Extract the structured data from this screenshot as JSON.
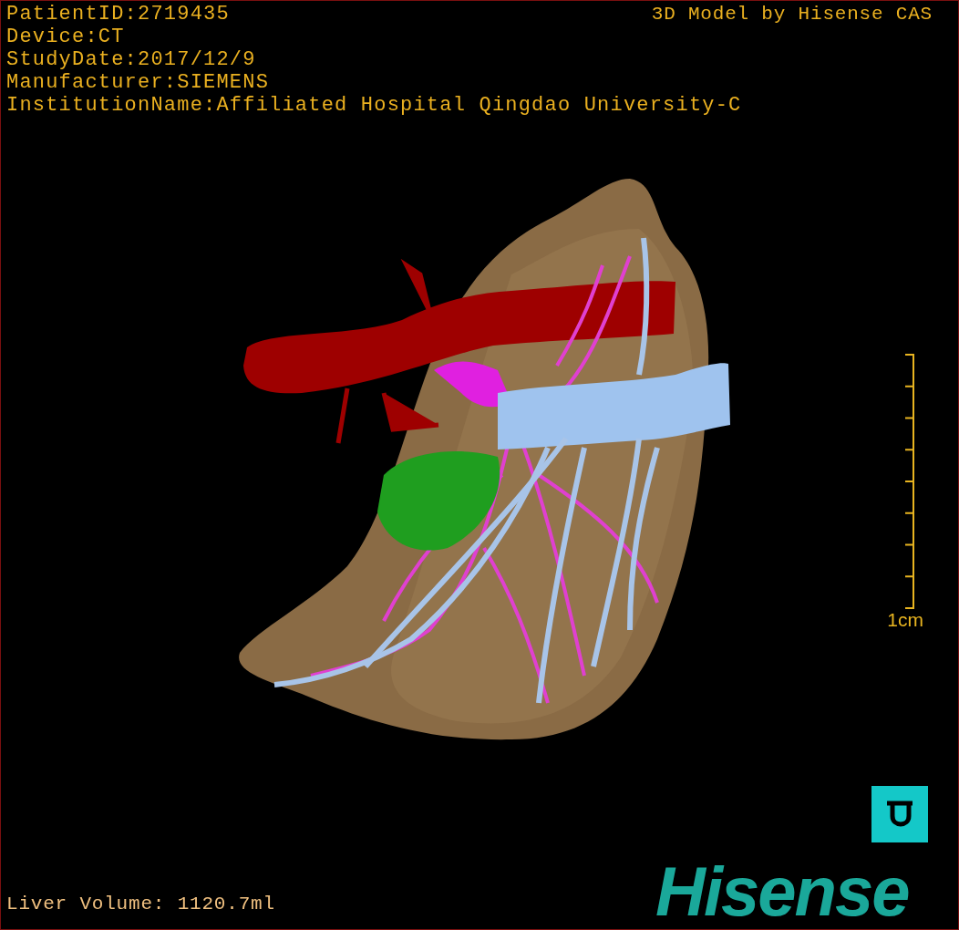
{
  "patient_info": [
    "PatientID:2719435",
    "Device:CT",
    "StudyDate:2017/12/9",
    "Manufacturer:SIEMENS",
    "InstitutionName:Affiliated Hospital Qingdao University-C"
  ],
  "model_title": "3D Model by Hisense CAS",
  "scale_bar": {
    "label": "1cm"
  },
  "liver_volume": "Liver Volume: 1120.7ml",
  "logo": {
    "text": "Hisense"
  }
}
